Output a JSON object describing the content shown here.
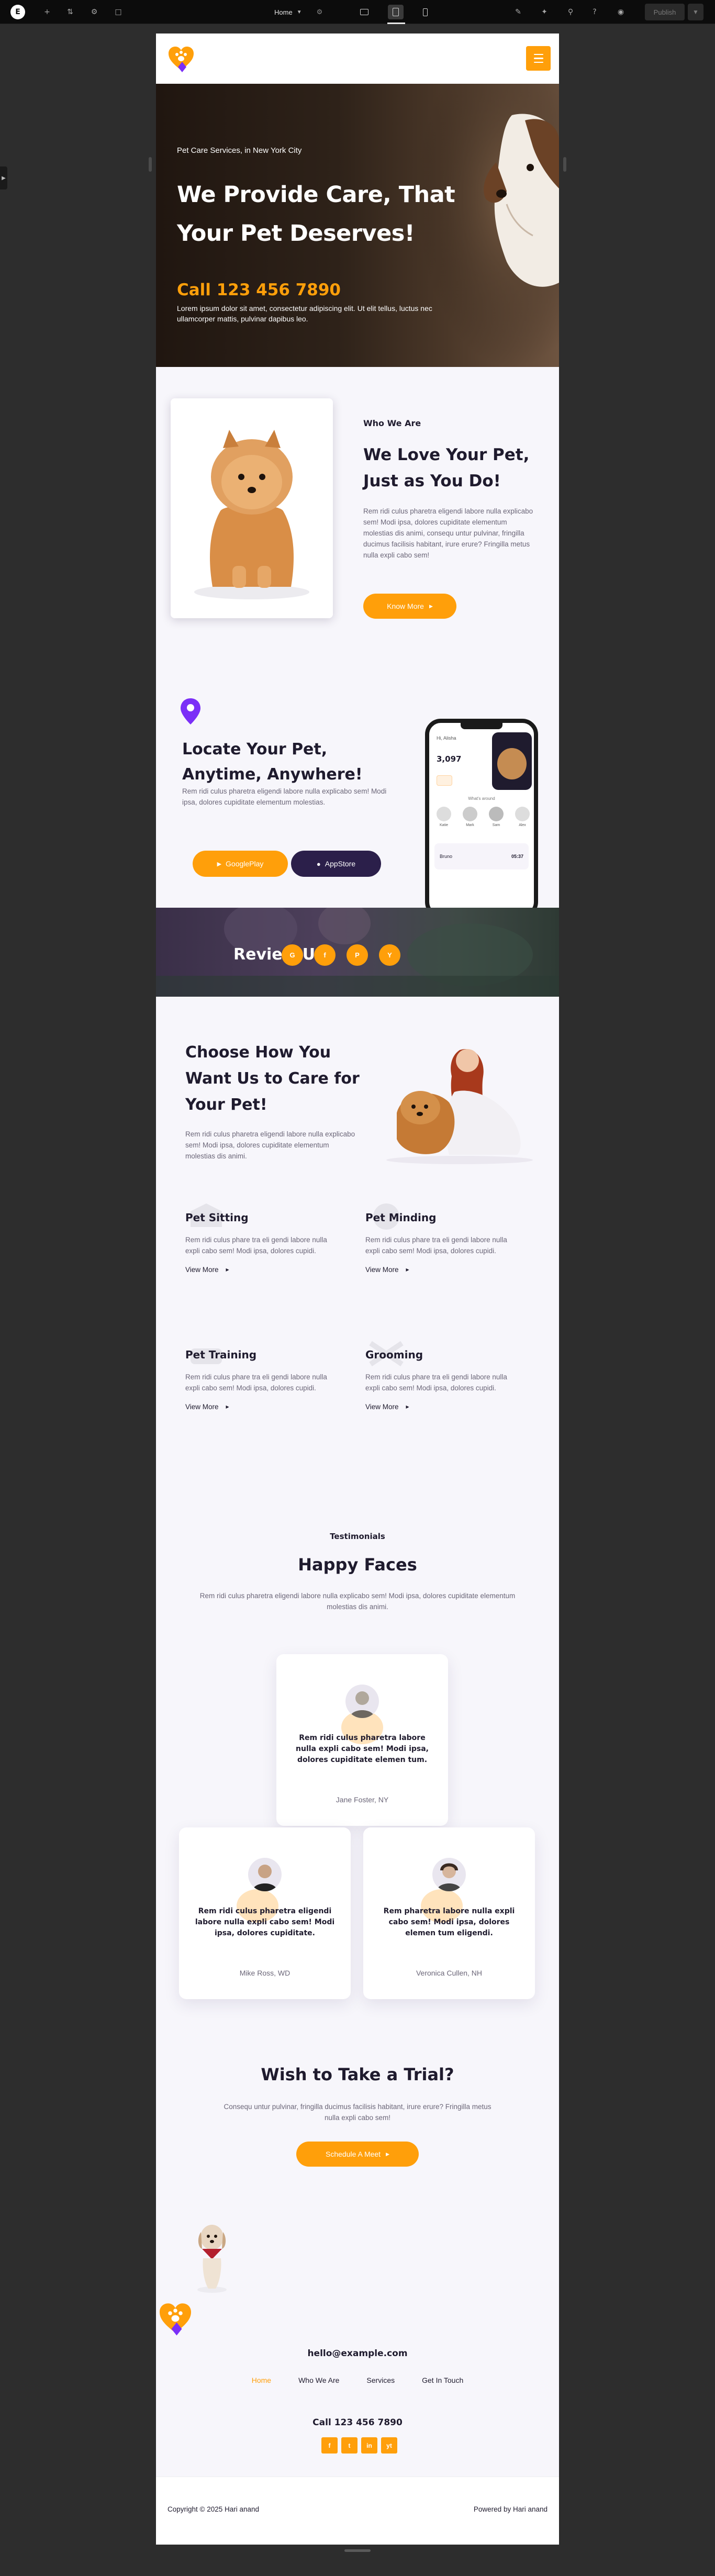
{
  "editor": {
    "page_name": "Home",
    "publish_label": "Publish"
  },
  "brand": {
    "accent": "#ff9f0a",
    "purple": "#7b2ff7",
    "dark": "#1f1b2e"
  },
  "hero": {
    "subtitle": "Pet Care Services, in New York City",
    "title": "We Provide Care, That Your Pet Deserves!",
    "phone": "Call 123 456 7890",
    "description": "Lorem ipsum dolor sit amet, consectetur adipiscing elit. Ut elit tellus, luctus nec ullamcorper mattis, pulvinar dapibus leo."
  },
  "who": {
    "tag": "Who We Are",
    "title": "We Love Your Pet, Just as You Do!",
    "description": "Rem ridi culus pharetra eligendi labore nulla explicabo sem! Modi ipsa, dolores cupiditate elementum molestias dis animi, consequ untur pulvinar, fringilla ducimus facilisis habitant, irure erure? Fringilla metus nulla expli cabo sem!",
    "button": "Know More"
  },
  "locate": {
    "title": "Locate Your Pet, Anytime, Anywhere!",
    "description": "Rem ridi culus pharetra eligendi labore nulla explicabo sem! Modi ipsa, dolores cupiditate elementum molestias.",
    "google_play": "GooglePlay",
    "app_store": "AppStore",
    "app_screen": {
      "greeting": "Hi, Alisha",
      "steps": "3,097",
      "section": "What's around",
      "people": [
        "Katie",
        "Mark",
        "Sam",
        "Alex"
      ],
      "bottom_name": "Bruno",
      "bottom_value": "05:37"
    }
  },
  "review": {
    "title": "Review Us",
    "sites": [
      "G",
      "f",
      "P",
      "Y"
    ]
  },
  "choose": {
    "title": "Choose How You Want Us to Care for Your Pet!",
    "description": "Rem ridi culus pharetra eligendi labore nulla explicabo sem! Modi ipsa, dolores cupiditate elementum molestias dis animi.",
    "services": [
      {
        "title": "Pet Sitting",
        "description": "Rem ridi culus phare tra eli gendi labore nulla expli cabo sem! Modi ipsa, dolores cupidi.",
        "link": "View More"
      },
      {
        "title": "Pet Minding",
        "description": "Rem ridi culus phare tra eli gendi labore nulla expli cabo sem! Modi ipsa, dolores cupidi.",
        "link": "View More"
      },
      {
        "title": "Pet Training",
        "description": "Rem ridi culus phare tra eli gendi labore nulla expli cabo sem! Modi ipsa, dolores cupidi.",
        "link": "View More"
      },
      {
        "title": "Grooming",
        "description": "Rem ridi culus phare tra eli gendi labore nulla expli cabo sem! Modi ipsa, dolores cupidi.",
        "link": "View More"
      }
    ]
  },
  "testimonials": {
    "tag": "Testimonials",
    "title": "Happy Faces",
    "description": "Rem ridi culus pharetra eligendi labore nulla explicabo sem! Modi ipsa, dolores cupiditate elementum molestias dis animi.",
    "items": [
      {
        "quote": "Rem ridi culus pharetra labore nulla expli cabo sem! Modi ipsa, dolores cupiditate elemen tum.",
        "name": "Jane Foster, NY"
      },
      {
        "quote": "Rem ridi culus pharetra eligendi labore nulla expli cabo sem! Modi ipsa, dolores cupiditate.",
        "name": "Mike Ross, WD"
      },
      {
        "quote": "Rem pharetra labore nulla expli cabo sem! Modi ipsa, dolores elemen tum eligendi.",
        "name": "Veronica Cullen, NH"
      }
    ]
  },
  "trial": {
    "title": "Wish to Take a Trial?",
    "description": "Consequ untur pulvinar, fringilla ducimus facilisis habitant, irure erure? Fringilla metus nulla expli cabo sem!",
    "button": "Schedule A Meet"
  },
  "footer": {
    "email": "hello@example.com",
    "nav": [
      "Home",
      "Who We Are",
      "Services",
      "Get In Touch"
    ],
    "phone": "Call 123 456 7890",
    "social": [
      "f",
      "t",
      "in",
      "yt"
    ],
    "copyright": "Copyright © 2025 Hari anand",
    "powered": "Powered by Hari anand"
  }
}
